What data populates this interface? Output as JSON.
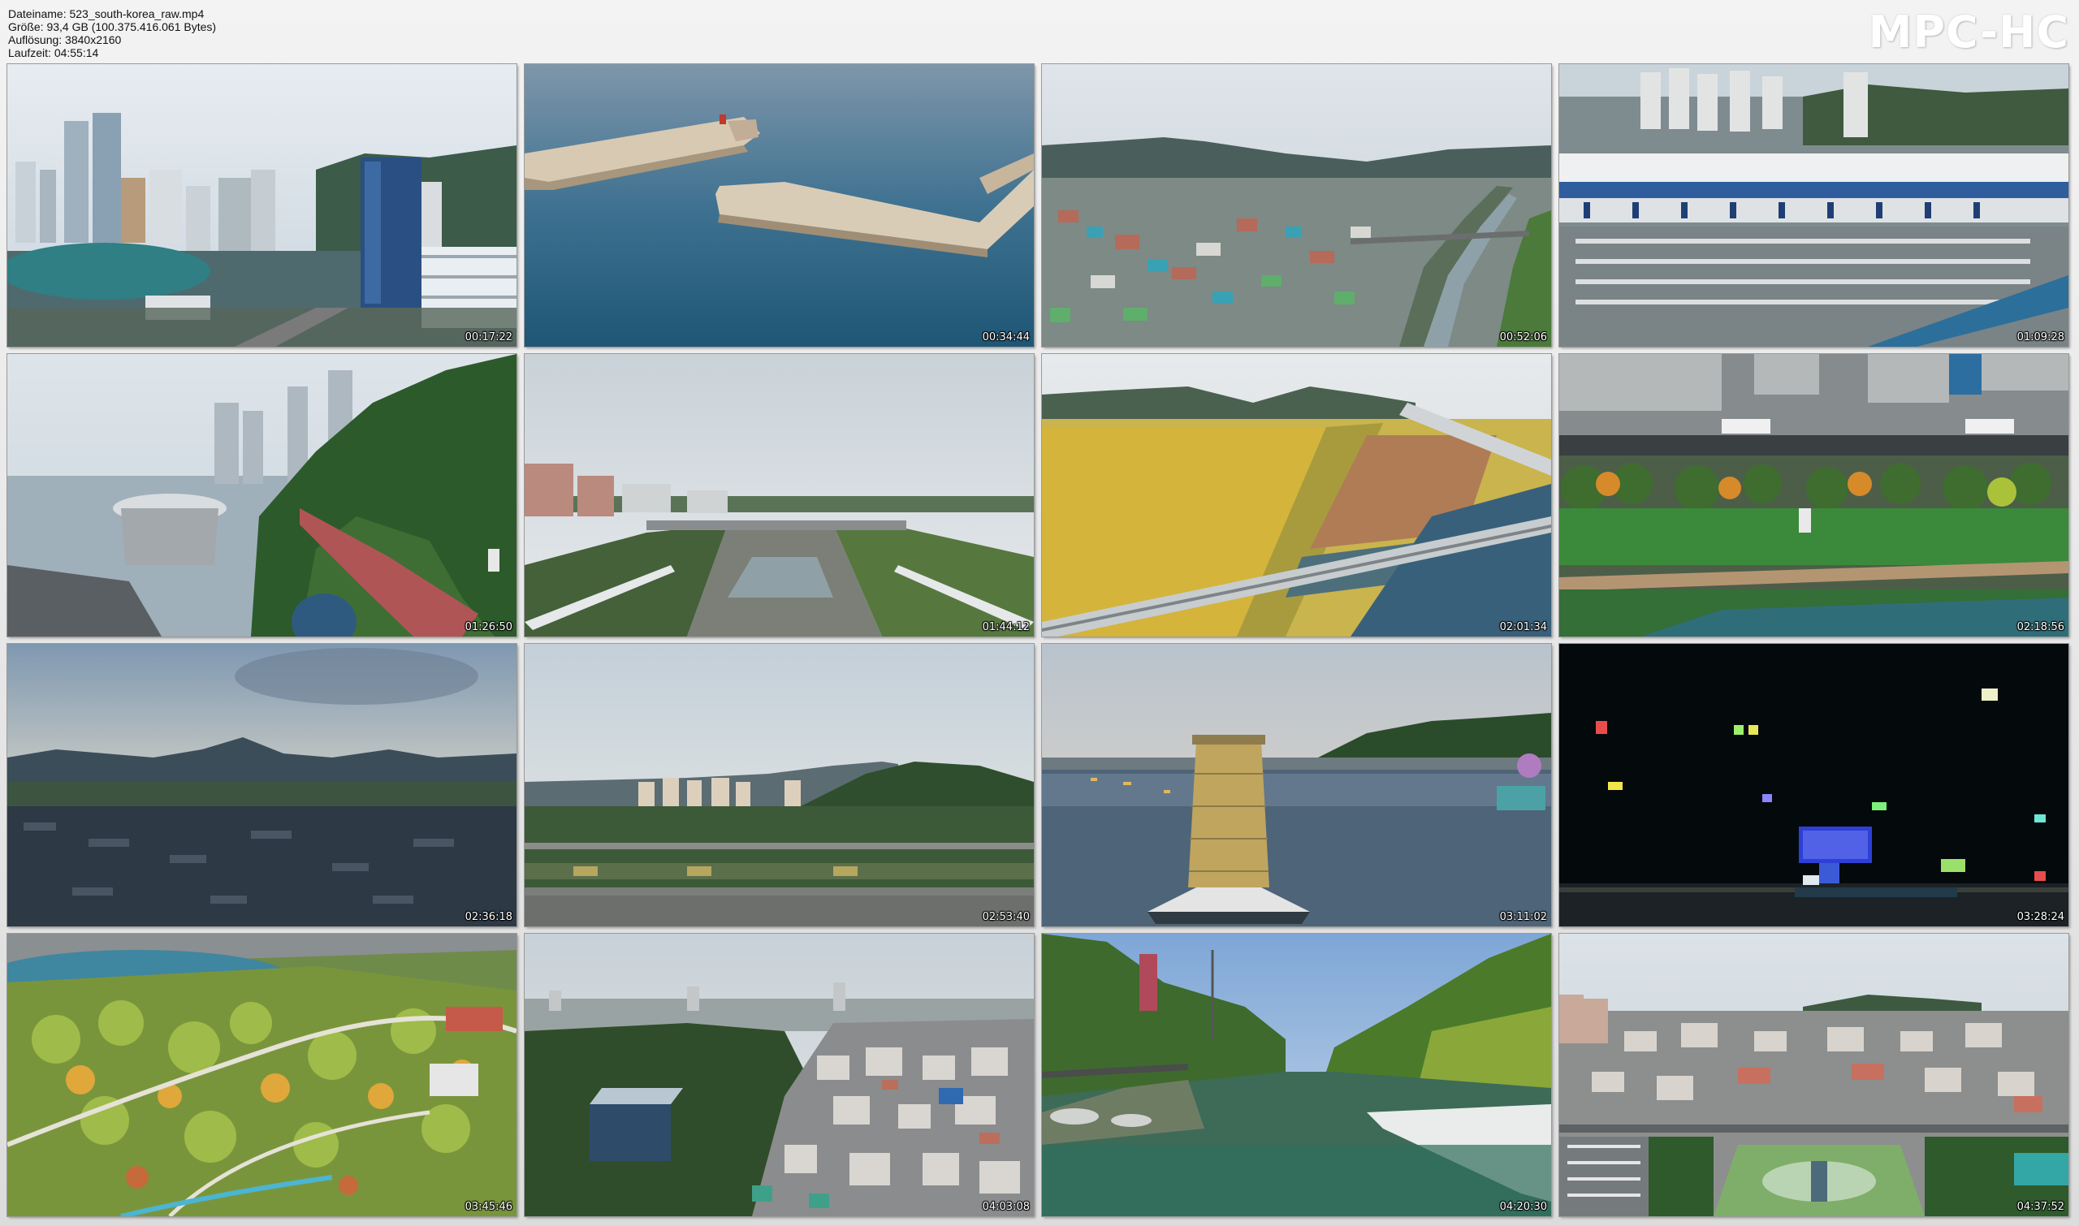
{
  "header": {
    "filename": "Dateiname: 523_south-korea_raw.mp4",
    "size": "Größe: 93,4 GB (100.375.416.061 Bytes)",
    "resolution": "Auflösung: 3840x2160",
    "duration": "Laufzeit: 04:55:14"
  },
  "brand": "MPC-HC",
  "thumbnails": [
    {
      "timestamp": "00:17:22",
      "scene": "city-skyline-harbor"
    },
    {
      "timestamp": "00:34:44",
      "scene": "sea-breakwater"
    },
    {
      "timestamp": "00:52:06",
      "scene": "city-river-valley"
    },
    {
      "timestamp": "01:09:28",
      "scene": "station-parking"
    },
    {
      "timestamp": "01:26:50",
      "scene": "coastal-park-towers"
    },
    {
      "timestamp": "01:44:12",
      "scene": "river-bridge-town"
    },
    {
      "timestamp": "02:01:34",
      "scene": "rice-fields-highway"
    },
    {
      "timestamp": "02:18:56",
      "scene": "park-street-topdown"
    },
    {
      "timestamp": "02:36:18",
      "scene": "dusk-town-mountains"
    },
    {
      "timestamp": "02:53:40",
      "scene": "forest-hill-apartments"
    },
    {
      "timestamp": "03:11:02",
      "scene": "lake-stone-tower"
    },
    {
      "timestamp": "03:28:24",
      "scene": "night-lanterns"
    },
    {
      "timestamp": "03:45:46",
      "scene": "garden-park-lake"
    },
    {
      "timestamp": "04:03:08",
      "scene": "dense-city-hill"
    },
    {
      "timestamp": "04:20:30",
      "scene": "mountain-stream"
    },
    {
      "timestamp": "04:37:52",
      "scene": "city-plaza-overview"
    }
  ]
}
